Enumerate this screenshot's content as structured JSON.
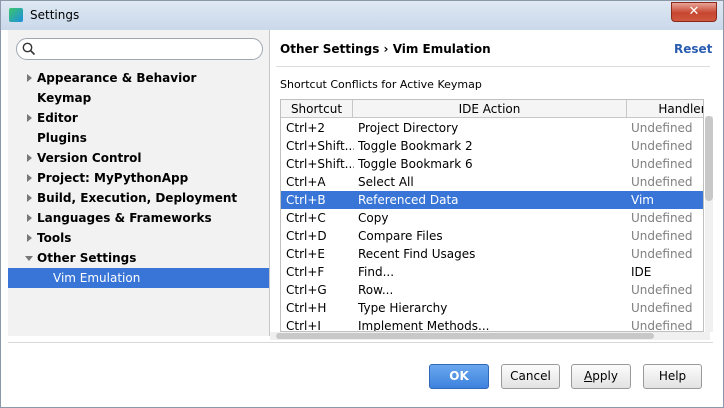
{
  "window": {
    "title": "Settings",
    "close_glyph": "✕"
  },
  "search": {
    "value": "",
    "placeholder": ""
  },
  "tree": {
    "items": [
      {
        "label": "Appearance & Behavior",
        "expandable": true
      },
      {
        "label": "Keymap",
        "expandable": false
      },
      {
        "label": "Editor",
        "expandable": true
      },
      {
        "label": "Plugins",
        "expandable": false
      },
      {
        "label": "Version Control",
        "expandable": true
      },
      {
        "label": "Project: MyPythonApp",
        "expandable": true
      },
      {
        "label": "Build, Execution, Deployment",
        "expandable": true
      },
      {
        "label": "Languages & Frameworks",
        "expandable": true
      },
      {
        "label": "Tools",
        "expandable": true
      },
      {
        "label": "Other Settings",
        "expandable": true,
        "expanded": true
      },
      {
        "label": "Vim Emulation",
        "child": true,
        "selected": true
      }
    ]
  },
  "header": {
    "breadcrumb_parent": "Other Settings",
    "breadcrumb_sep": "›",
    "breadcrumb_current": "Vim Emulation",
    "reset_label": "Reset"
  },
  "section_title": "Shortcut Conflicts for Active Keymap",
  "table": {
    "columns": [
      "Shortcut",
      "IDE Action",
      "Handler"
    ],
    "rows": [
      {
        "shortcut": "Ctrl+2",
        "action": "Project Directory",
        "handler": "Undefined"
      },
      {
        "shortcut": "Ctrl+Shift...",
        "action": "Toggle Bookmark 2",
        "handler": "Undefined"
      },
      {
        "shortcut": "Ctrl+Shift...",
        "action": "Toggle Bookmark 6",
        "handler": "Undefined"
      },
      {
        "shortcut": "Ctrl+A",
        "action": "Select All",
        "handler": "Undefined"
      },
      {
        "shortcut": "Ctrl+B",
        "action": "Referenced Data",
        "handler": "Vim",
        "selected": true
      },
      {
        "shortcut": "Ctrl+C",
        "action": "Copy",
        "handler": "Undefined"
      },
      {
        "shortcut": "Ctrl+D",
        "action": "Compare Files",
        "handler": "Undefined"
      },
      {
        "shortcut": "Ctrl+E",
        "action": "Recent Find Usages",
        "handler": "Undefined"
      },
      {
        "shortcut": "Ctrl+F",
        "action": "Find...",
        "handler": "IDE"
      },
      {
        "shortcut": "Ctrl+G",
        "action": "Row...",
        "handler": "Undefined"
      },
      {
        "shortcut": "Ctrl+H",
        "action": "Type Hierarchy",
        "handler": "Undefined"
      },
      {
        "shortcut": "Ctrl+I",
        "action": "Implement Methods...",
        "handler": "Undefined"
      }
    ]
  },
  "buttons": {
    "ok": "OK",
    "cancel": "Cancel",
    "apply_underlined": "A",
    "apply_rest": "pply",
    "help": "Help"
  },
  "colors": {
    "selection": "#3875d7",
    "link": "#2a5db0",
    "muted": "#808080"
  }
}
